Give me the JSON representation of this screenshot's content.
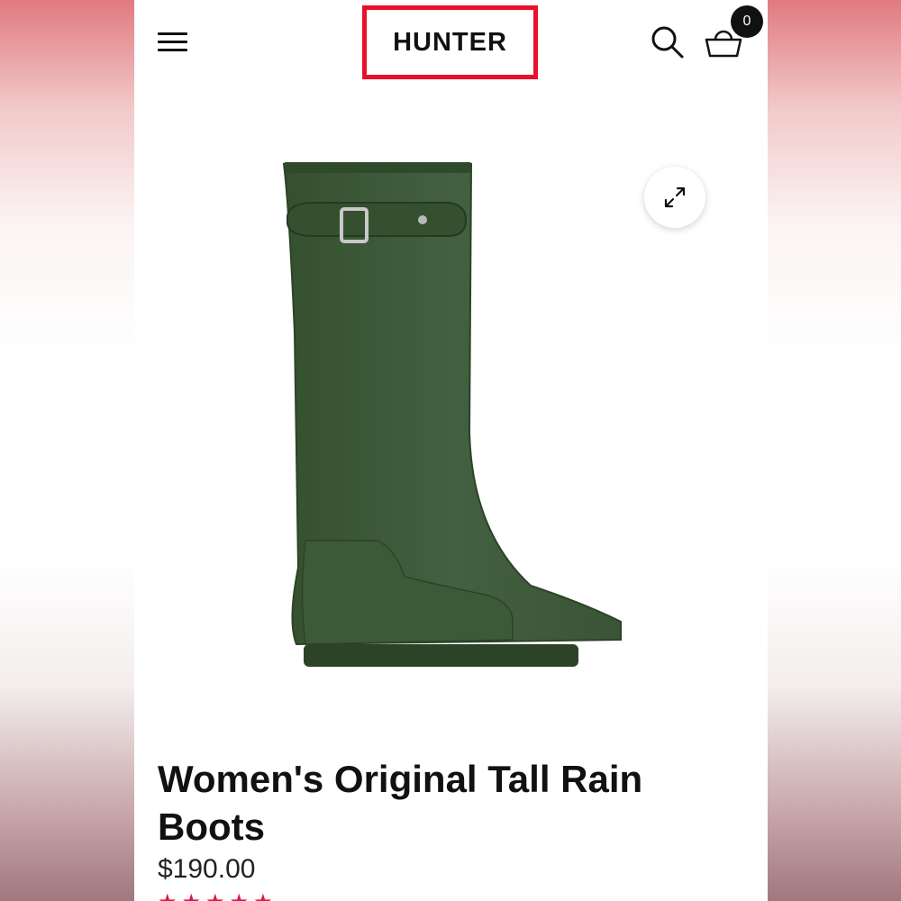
{
  "header": {
    "logo_text": "HUNTER",
    "cart_count": "0"
  },
  "icons": {
    "menu": "hamburger-icon",
    "search": "search-icon",
    "cart": "basket-icon",
    "expand": "expand-icon"
  },
  "product": {
    "title": "Women's Original Tall Rain Boots",
    "price": "$190.00",
    "rating_stars": "★★★★★",
    "boot_color": "#3f5a3a"
  },
  "colors": {
    "brand_red": "#e8102c",
    "rating_pink": "#d81b48"
  }
}
